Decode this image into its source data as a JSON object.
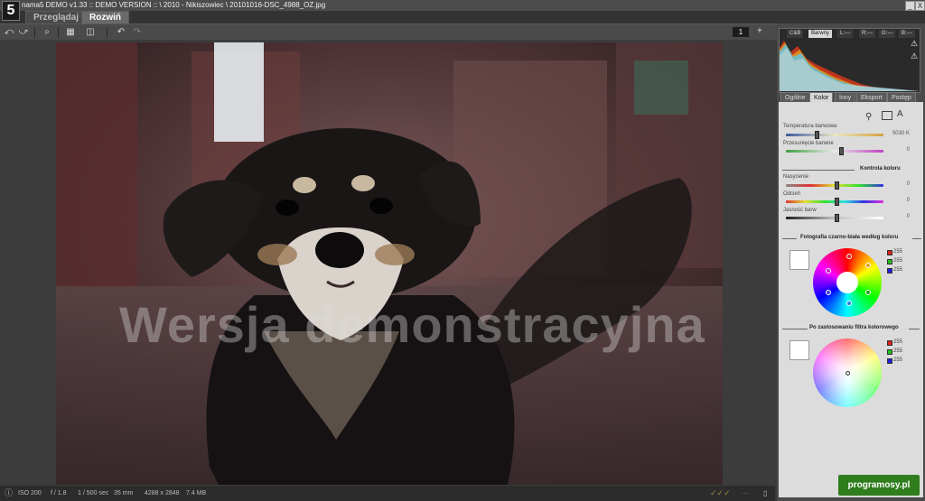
{
  "window": {
    "title": "nama5 DEMO v1.33 :: DEMO VERSION :: \\ 2010 - Nikiszowiec \\ 20101016-DSC_4988_OZ.jpg",
    "logo": "5",
    "minimize_symbol": "_",
    "close_symbol": "X"
  },
  "tabs": [
    {
      "label": "Przeglądaj"
    },
    {
      "label": "Rozwiń"
    }
  ],
  "toolbar": {
    "page_number": "1",
    "add_symbol": "+"
  },
  "photo": {
    "watermark": "Wersja demonstracyjna"
  },
  "status": {
    "iso": "ISO 200",
    "aperture": "f / 1.8",
    "shutter": "1 / 500 sec",
    "focal": "35 mm",
    "dimensions": "4288 x 2848",
    "filesize": "7.4 MB"
  },
  "histogram": {
    "tabs": [
      "C&B",
      "Barwny",
      "L:---",
      "R:---",
      "G:---",
      "B:---"
    ]
  },
  "panel": {
    "tabs": [
      "Ogólne",
      "Kolor",
      "Inny",
      "Eksport",
      "Postęp"
    ],
    "temperature": {
      "label": "Temperatura barwowa",
      "value": "5030 K"
    },
    "tint": {
      "label": "Przesunięcie barwne",
      "value": "0"
    },
    "color_control": {
      "title": "Kontrola koloru"
    },
    "saturation": {
      "label": "Nasycenie",
      "value": "0"
    },
    "hue": {
      "label": "Odcień",
      "value": "0"
    },
    "brightness": {
      "label": "Jasność barw",
      "value": "0"
    },
    "bw_section": {
      "title": "Fotografia czarno-biała według koloru",
      "r": "255",
      "g": "255",
      "b": "255"
    },
    "filter_section": {
      "title": "Po zastosowaniu filtra kolorowego",
      "r": "255",
      "g": "255",
      "b": "255"
    }
  },
  "brand": {
    "text": "programosy.pl"
  }
}
